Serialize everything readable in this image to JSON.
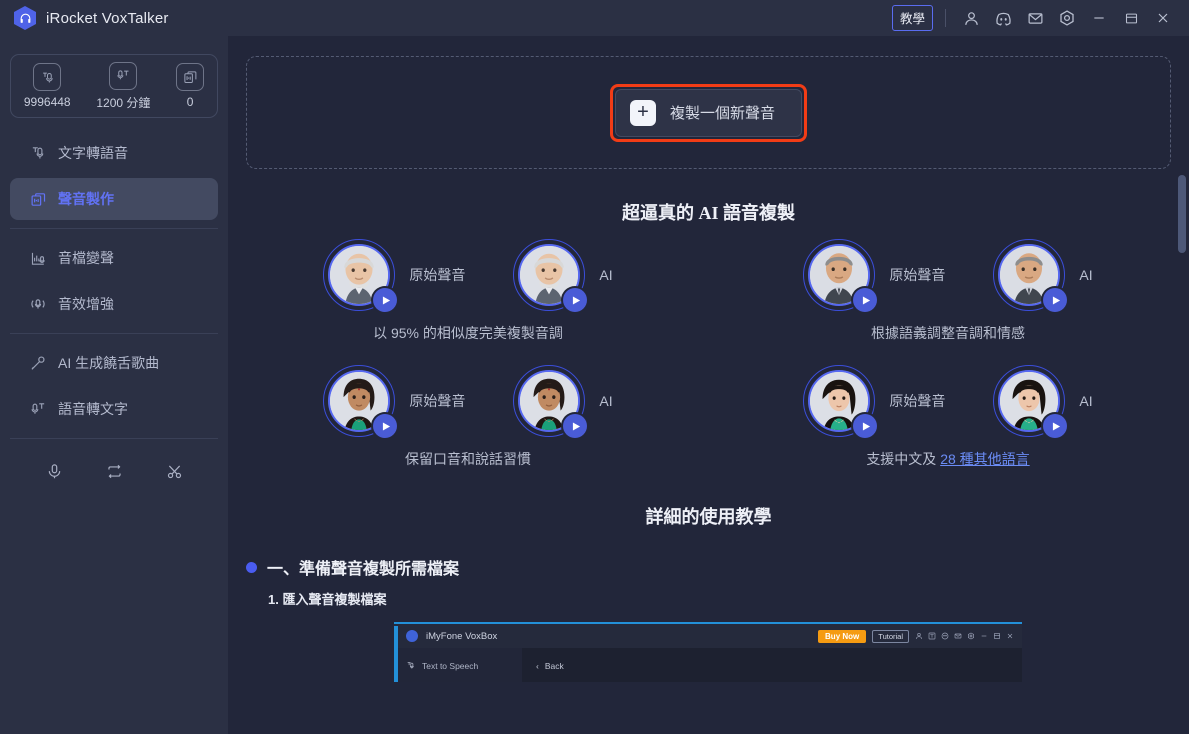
{
  "titlebar": {
    "app_title": "iRocket VoxTalker",
    "logo_icon": "headphone-hexagon-logo",
    "tutorial_label": "教學",
    "icons": [
      {
        "name": "account-icon",
        "glyph": "person"
      },
      {
        "name": "discord-icon",
        "glyph": "discord"
      },
      {
        "name": "mail-icon",
        "glyph": "envelope"
      },
      {
        "name": "settings-icon",
        "glyph": "gear-hex"
      },
      {
        "name": "minimize-icon",
        "glyph": "minus"
      },
      {
        "name": "maximize-icon",
        "glyph": "square"
      },
      {
        "name": "close-icon",
        "glyph": "cross"
      }
    ]
  },
  "sidebar": {
    "credits": [
      {
        "icon": "tts-characters-icon",
        "value": "9996448"
      },
      {
        "icon": "voice-minutes-icon",
        "value": "1200 分鐘"
      },
      {
        "icon": "voice-clone-count-icon",
        "value": "0"
      }
    ],
    "items": [
      {
        "label": "文字轉語音",
        "icon": "text-to-speech-icon",
        "active": false
      },
      {
        "label": "聲音製作",
        "icon": "voice-cloning-icon",
        "active": true
      },
      {
        "label": "音檔變聲",
        "icon": "voice-changer-icon",
        "active": false
      },
      {
        "label": "音效增強",
        "icon": "audio-enhance-icon",
        "active": false
      },
      {
        "label": "AI 生成饒舌歌曲",
        "icon": "ai-rap-icon",
        "active": false
      },
      {
        "label": "語音轉文字",
        "icon": "speech-to-text-icon",
        "active": false
      }
    ],
    "bottom_icons": [
      {
        "name": "recorder-icon"
      },
      {
        "name": "loop-icon"
      },
      {
        "name": "cut-icon"
      }
    ]
  },
  "main": {
    "clone_button": {
      "plus": "+",
      "label": "複製一個新聲音",
      "highlight_color": "#f23c16"
    },
    "section_title": "超逼真的 AI 語音複製",
    "demo_rows": [
      {
        "groups": [
          {
            "pairs": [
              {
                "label": "原始聲音",
                "avatar": "elderly-man-avatar"
              },
              {
                "label": "AI",
                "avatar": "elderly-man-avatar"
              }
            ],
            "caption_prefix": "以 95% 的相似度完美複製音調",
            "link": null,
            "caption_suffix": ""
          },
          {
            "pairs": [
              {
                "label": "原始聲音",
                "avatar": "mature-man-avatar"
              },
              {
                "label": "AI",
                "avatar": "mature-man-avatar"
              }
            ],
            "caption_prefix": "根據語義調整音調和情感",
            "link": null,
            "caption_suffix": ""
          }
        ]
      },
      {
        "groups": [
          {
            "pairs": [
              {
                "label": "原始聲音",
                "avatar": "indian-woman-avatar"
              },
              {
                "label": "AI",
                "avatar": "indian-woman-avatar"
              }
            ],
            "caption_prefix": "保留口音和說話習慣",
            "link": null,
            "caption_suffix": ""
          },
          {
            "pairs": [
              {
                "label": "原始聲音",
                "avatar": "asian-woman-avatar"
              },
              {
                "label": "AI",
                "avatar": "asian-woman-avatar"
              }
            ],
            "caption_prefix": "支援中文及 ",
            "link": "28 種其他語言",
            "caption_suffix": ""
          }
        ]
      }
    ],
    "tutorial_title": "詳細的使用教學",
    "tutorial_heading": "一、準備聲音複製所需檔案",
    "tutorial_substep": "1. 匯入聲音複製檔案",
    "screenshot": {
      "app_name": "iMyFone VoxBox",
      "buy_now": "Buy Now",
      "tutorial": "Tutorial",
      "sidebar_item": "Text to Speech",
      "back": "Back",
      "back_chevron": "‹"
    }
  },
  "theme": {
    "bg": "#22263a",
    "panel": "#2b3044",
    "accent": "#5a6cf0",
    "active_bg": "#434a61",
    "highlight": "#f23c16",
    "link": "#6b8cf5"
  }
}
